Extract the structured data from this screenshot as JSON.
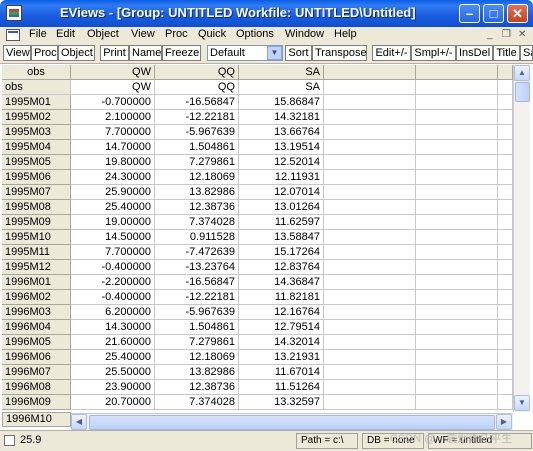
{
  "window": {
    "title": "EViews - [Group: UNTITLED    Workfile: UNTITLED\\Untitled]",
    "buttons": {
      "minimize": "–",
      "maximize": "□",
      "close": "✕"
    }
  },
  "menu": [
    "File",
    "Edit",
    "Object",
    "View",
    "Proc",
    "Quick",
    "Options",
    "Window",
    "Help"
  ],
  "menu_controls": {
    "minimize": "_",
    "restore": "❐",
    "close": "✕"
  },
  "toolbar": {
    "view": "View",
    "proc": "Proc",
    "object": "Object",
    "print": "Print",
    "name": "Name",
    "freeze": "Freeze",
    "select_value": "Default",
    "sort": "Sort",
    "transpose": "Transpose",
    "edit": "Edit+/-",
    "smpl": "Smpl+/-",
    "insdel": "InsDel",
    "title": "Title",
    "sa": "Sa"
  },
  "grid": {
    "header": [
      "obs",
      "QW",
      "QQ",
      "SA"
    ],
    "subheader": [
      "obs",
      "QW",
      "QQ",
      "SA"
    ],
    "rows": [
      [
        "1995M01",
        "-0.700000",
        "-16.56847",
        "15.86847"
      ],
      [
        "1995M02",
        "2.100000",
        "-12.22181",
        "14.32181"
      ],
      [
        "1995M03",
        "7.700000",
        "-5.967639",
        "13.66764"
      ],
      [
        "1995M04",
        "14.70000",
        "1.504861",
        "13.19514"
      ],
      [
        "1995M05",
        "19.80000",
        "7.279861",
        "12.52014"
      ],
      [
        "1995M06",
        "24.30000",
        "12.18069",
        "12.11931"
      ],
      [
        "1995M07",
        "25.90000",
        "13.82986",
        "12.07014"
      ],
      [
        "1995M08",
        "25.40000",
        "12.38736",
        "13.01264"
      ],
      [
        "1995M09",
        "19.00000",
        "7.374028",
        "11.62597"
      ],
      [
        "1995M10",
        "14.50000",
        "0.911528",
        "13.58847"
      ],
      [
        "1995M11",
        "7.700000",
        "-7.472639",
        "15.17264"
      ],
      [
        "1995M12",
        "-0.400000",
        "-13.23764",
        "12.83764"
      ],
      [
        "1996M01",
        "-2.200000",
        "-16.56847",
        "14.36847"
      ],
      [
        "1996M02",
        "-0.400000",
        "-12.22181",
        "11.82181"
      ],
      [
        "1996M03",
        "6.200000",
        "-5.967639",
        "12.16764"
      ],
      [
        "1996M04",
        "14.30000",
        "1.504861",
        "12.79514"
      ],
      [
        "1996M05",
        "21.60000",
        "7.279861",
        "14.32014"
      ],
      [
        "1996M06",
        "25.40000",
        "12.18069",
        "13.21931"
      ],
      [
        "1996M07",
        "25.50000",
        "13.82986",
        "11.67014"
      ],
      [
        "1996M08",
        "23.90000",
        "12.38736",
        "11.51264"
      ],
      [
        "1996M09",
        "20.70000",
        "7.374028",
        "13.32597"
      ]
    ],
    "last_visible_obs": "1996M10"
  },
  "status": {
    "value": "25.9",
    "path": "Path = c:\\",
    "db": "DB = none",
    "wf": "WF = untitled"
  },
  "watermark": "CSDN @一蓑烟雨任平生"
}
